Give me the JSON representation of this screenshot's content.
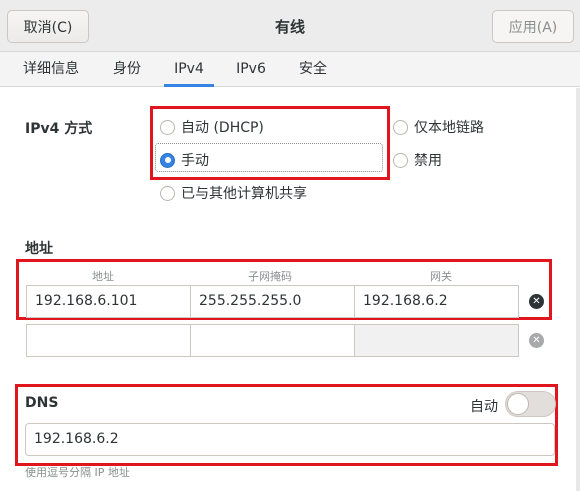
{
  "header": {
    "cancel_label": "取消(C)",
    "title": "有线",
    "apply_label": "应用(A)"
  },
  "tabs": [
    {
      "label": "详细信息"
    },
    {
      "label": "身份"
    },
    {
      "label": "IPv4",
      "active": true
    },
    {
      "label": "IPv6"
    },
    {
      "label": "安全"
    }
  ],
  "ipv4": {
    "method_label": "IPv4 方式",
    "options": [
      {
        "label": "自动 (DHCP)",
        "checked": false
      },
      {
        "label": "仅本地链路",
        "checked": false
      },
      {
        "label": "手动",
        "checked": true
      },
      {
        "label": "禁用",
        "checked": false
      },
      {
        "label": "已与其他计算机共享",
        "checked": false
      }
    ]
  },
  "addresses": {
    "section_label": "地址",
    "columns": [
      "地址",
      "子网掩码",
      "网关"
    ],
    "rows": [
      {
        "address": "192.168.6.101",
        "netmask": "255.255.255.0",
        "gateway": "192.168.6.2"
      },
      {
        "address": "",
        "netmask": "",
        "gateway": ""
      }
    ]
  },
  "dns": {
    "section_label": "DNS",
    "auto_label": "自动",
    "auto_enabled": false,
    "value": "192.168.6.2",
    "hint": "使用逗号分隔 IP 地址"
  },
  "colors": {
    "accent": "#3584e4",
    "highlight_box": "#e1151e"
  }
}
